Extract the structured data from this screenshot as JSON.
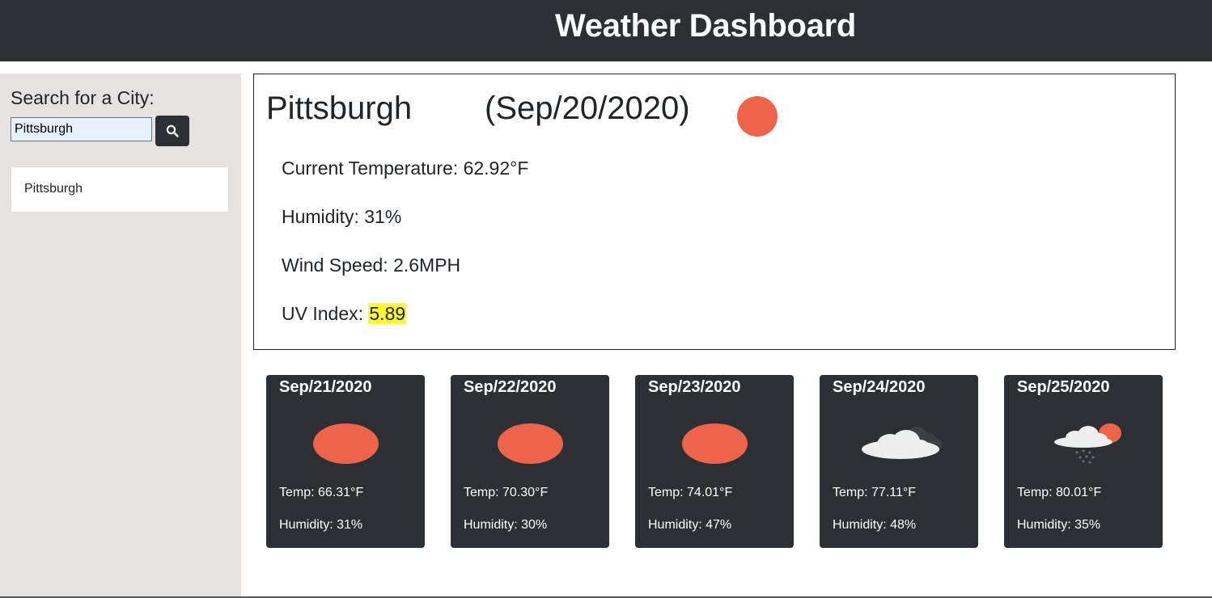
{
  "header": {
    "title": "Weather Dashboard"
  },
  "sidebar": {
    "search_label": "Search for a City:",
    "search_value": "Pittsburgh",
    "history": [
      {
        "label": "Pittsburgh"
      }
    ]
  },
  "current": {
    "city": "Pittsburgh",
    "date": "(Sep/20/2020)",
    "icon": "sun-icon",
    "temperature": "Current Temperature: 62.92°F",
    "humidity": "Humidity: 31%",
    "wind": "Wind Speed: 2.6MPH",
    "uv_label": "UV Index: ",
    "uv_value": "5.89"
  },
  "forecast": [
    {
      "date": "Sep/21/2020",
      "icon": "sun-icon",
      "temp": "Temp: 66.31°F",
      "humidity": "Humidity: 31%"
    },
    {
      "date": "Sep/22/2020",
      "icon": "sun-icon",
      "temp": "Temp: 70.30°F",
      "humidity": "Humidity: 30%"
    },
    {
      "date": "Sep/23/2020",
      "icon": "sun-icon",
      "temp": "Temp: 74.01°F",
      "humidity": "Humidity: 47%"
    },
    {
      "date": "Sep/24/2020",
      "icon": "cloudy-icon",
      "temp": "Temp: 77.11°F",
      "humidity": "Humidity: 48%"
    },
    {
      "date": "Sep/25/2020",
      "icon": "rain-sun-icon",
      "temp": "Temp: 80.01°F",
      "humidity": "Humidity: 35%"
    }
  ],
  "colors": {
    "header_bg": "#2c3035",
    "sidebar_bg": "#e5e2e1",
    "sun": "#ee644b",
    "uv_highlight": "#fbfb38",
    "card_bg": "#2c3035"
  }
}
